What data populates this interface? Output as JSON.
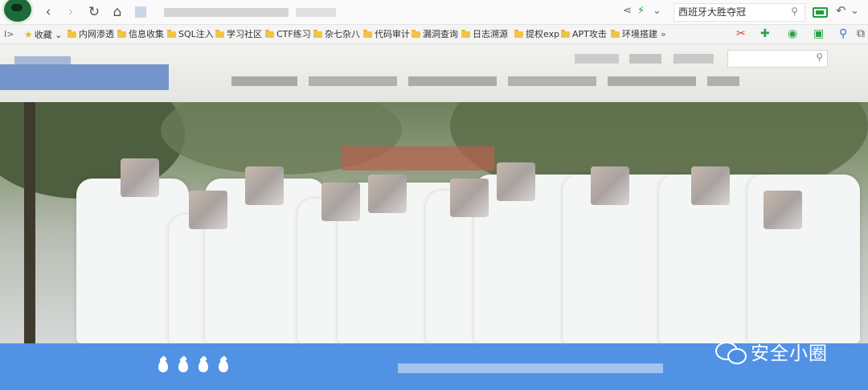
{
  "browser": {
    "search_value": "西班牙大胜夺冠",
    "icons": [
      "back-icon",
      "forward-icon",
      "refresh-icon",
      "home-icon",
      "share-icon",
      "bolt-icon",
      "chevron-down-icon",
      "search-icon",
      "battery-icon",
      "undo-icon",
      "menu-icon"
    ]
  },
  "bookmarks": {
    "favorites_label": "收藏",
    "items": [
      "内网渗透",
      "信息收集",
      "SQL注入",
      "学习社区",
      "CTF练习",
      "杂七杂八",
      "代码审计",
      "漏洞查询",
      "日志溯源",
      "提权exp",
      "APT攻击",
      "环境搭建"
    ],
    "more": "»",
    "sidebar_toggle": "I>"
  },
  "extensions": [
    "scissors-icon",
    "plus-icon",
    "shield-icon",
    "gamepad-icon",
    "search-icon",
    "copy-icon"
  ],
  "watermark": {
    "text": "安全小圈",
    "icon": "wechat-icon"
  },
  "carousel": {
    "dot_count": 4
  },
  "colors": {
    "blue_bar": "#4b8ee4",
    "folder": "#f2c443",
    "battery": "#1a9f3b"
  }
}
